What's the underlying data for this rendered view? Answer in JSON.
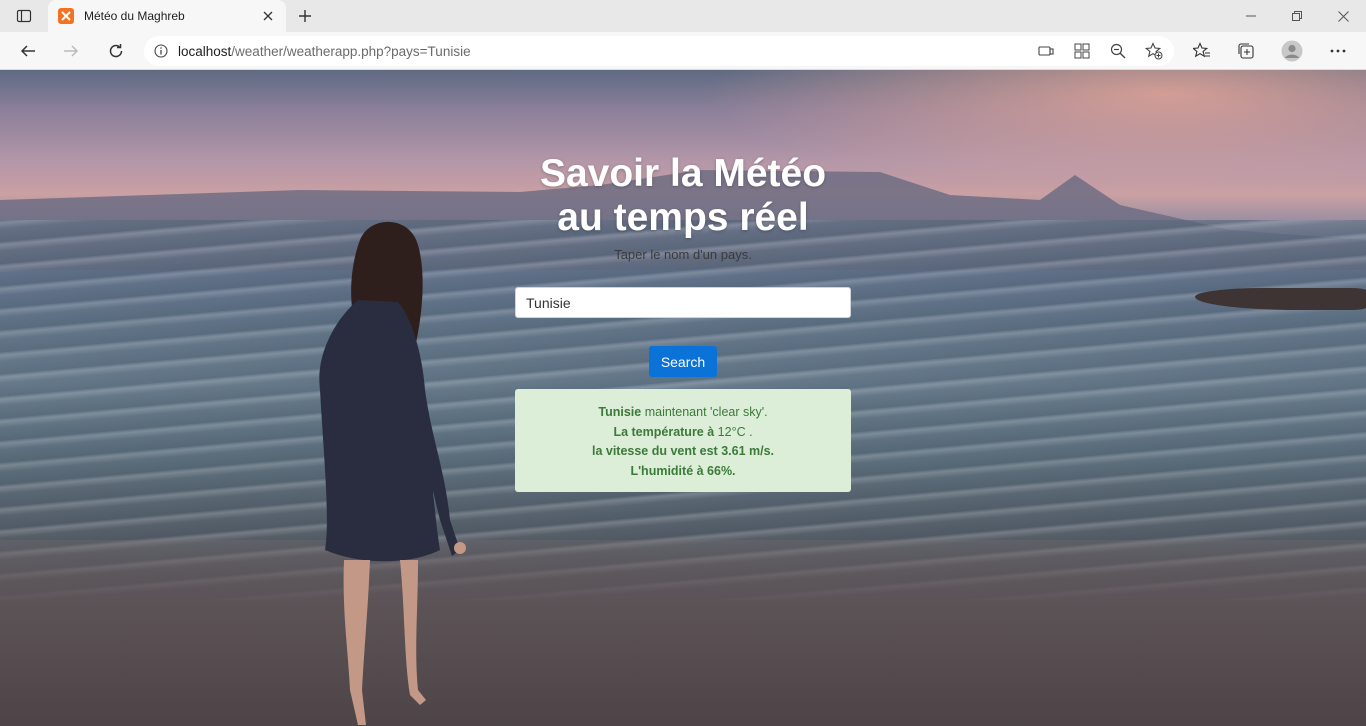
{
  "browser": {
    "tab_title": "Météo du Maghreb",
    "url_host": "localhost",
    "url_path": "/weather/weatherapp.php?pays=Tunisie"
  },
  "page": {
    "title_line1": "Savoir la Météo",
    "title_line2": "au temps réel",
    "subtitle": "Taper le nom d'un pays.",
    "search": {
      "value": "Tunisie",
      "button_label": "Search"
    },
    "result": {
      "country": "Tunisie",
      "condition_text": " maintenant 'clear sky'.",
      "temp_label": "La température à",
      "temp_value": " 12°C .",
      "wind_text": "la vitesse du vent est 3.61 m/s.",
      "humidity_text": "L'humidité à 66%."
    }
  },
  "colors": {
    "button": "#0b72d8",
    "result_bg": "#dcedd8",
    "result_text": "#3c7a3a",
    "favicon": "#f37321"
  }
}
